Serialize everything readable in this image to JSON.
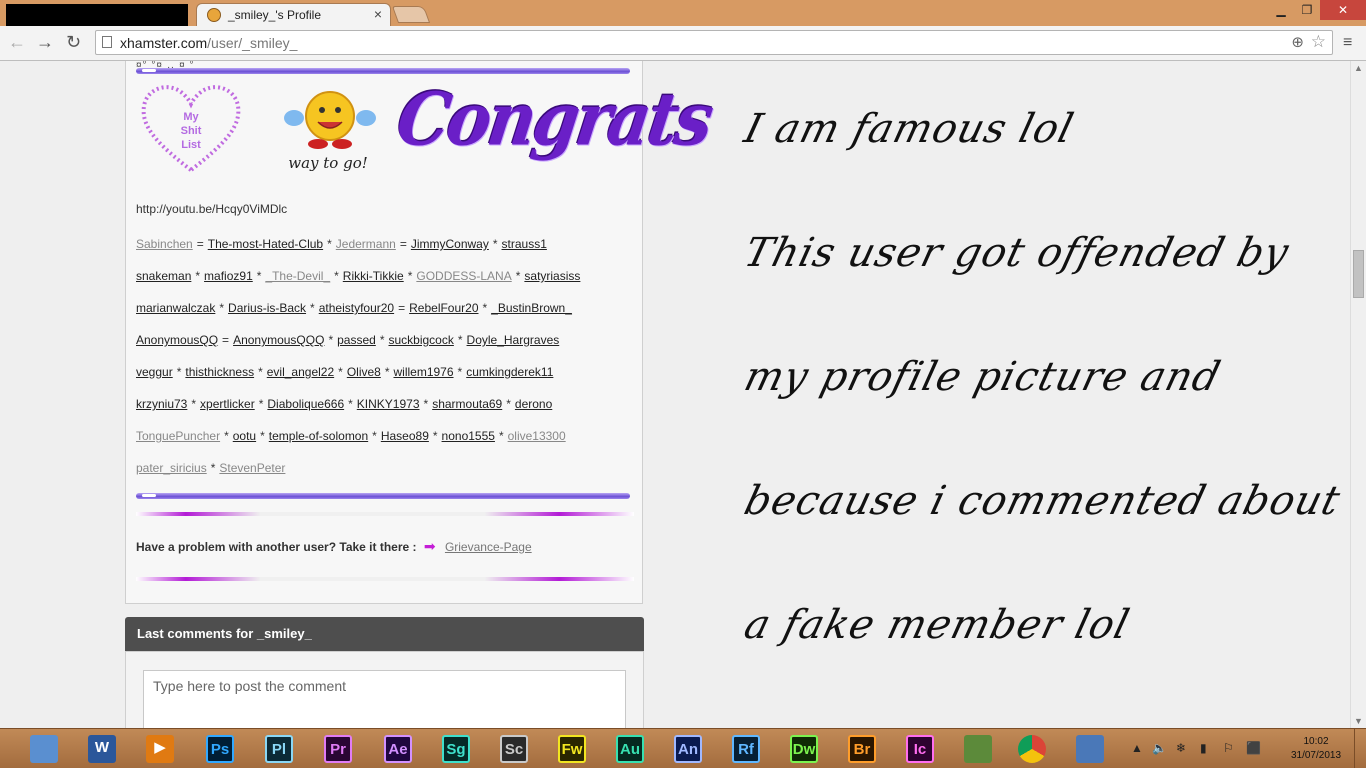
{
  "browser": {
    "tab_title": "_smiley_'s Profile",
    "tab_close": "×",
    "url_host": "xhamster.com",
    "url_path": "/user/_smiley_",
    "window_buttons": {
      "minimize": "▁",
      "maximize": "❐",
      "close": "✕"
    },
    "nav": {
      "back": "←",
      "forward": "→",
      "reload": "↻",
      "zoom": "⊕",
      "star": "☆",
      "menu": "≡"
    }
  },
  "profile": {
    "glyph_line": "¤°         °¤¸..¸¤ °",
    "heart_text": [
      "My",
      "Shit",
      "List"
    ],
    "smiley_caption": "way to go!",
    "congrats_text": "Congrats",
    "youtube_link": "http://youtu.be/Hcqy0ViMDlc",
    "user_lines": [
      [
        {
          "t": "Sabinchen",
          "g": 1
        },
        {
          "s": "="
        },
        {
          "t": "The-most-Hated-Club"
        },
        {
          "s": "*"
        },
        {
          "t": "Jedermann",
          "g": 1
        },
        {
          "s": "="
        },
        {
          "t": "JimmyConway"
        },
        {
          "s": "*"
        },
        {
          "t": "strauss1"
        }
      ],
      [
        {
          "t": "snakeman"
        },
        {
          "s": "*"
        },
        {
          "t": "mafioz91"
        },
        {
          "s": "*"
        },
        {
          "t": "_The-Devil_",
          "g": 1
        },
        {
          "s": "*"
        },
        {
          "t": "Rikki-Tikkie"
        },
        {
          "s": "*"
        },
        {
          "t": "GODDESS-LANA",
          "g": 1
        },
        {
          "s": "*"
        },
        {
          "t": "satyriasiss"
        }
      ],
      [
        {
          "t": "marianwalczak"
        },
        {
          "s": "*"
        },
        {
          "t": "Darius-is-Back"
        },
        {
          "s": "*"
        },
        {
          "t": "atheistyfour20"
        },
        {
          "s": "="
        },
        {
          "t": "RebelFour20"
        },
        {
          "s": "*"
        },
        {
          "t": "_BustinBrown_"
        }
      ],
      [
        {
          "t": "AnonymousQQ"
        },
        {
          "s": "="
        },
        {
          "t": "AnonymousQQQ"
        },
        {
          "s": "*"
        },
        {
          "t": "passed"
        },
        {
          "s": "*"
        },
        {
          "t": "suckbigcock"
        },
        {
          "s": "*"
        },
        {
          "t": "Doyle_Hargraves"
        }
      ],
      [
        {
          "t": "veggur"
        },
        {
          "s": "*"
        },
        {
          "t": "thisthickness"
        },
        {
          "s": "*"
        },
        {
          "t": "evil_angel22"
        },
        {
          "s": "*"
        },
        {
          "t": "Olive8"
        },
        {
          "s": "*"
        },
        {
          "t": "willem1976"
        },
        {
          "s": "*"
        },
        {
          "t": "cumkingderek11"
        }
      ],
      [
        {
          "t": "krzyniu73"
        },
        {
          "s": "*"
        },
        {
          "t": "xpertlicker"
        },
        {
          "s": "*"
        },
        {
          "t": "Diabolique666"
        },
        {
          "s": "*"
        },
        {
          "t": "KINKY1973"
        },
        {
          "s": "*"
        },
        {
          "t": "sharmouta69"
        },
        {
          "s": "*"
        },
        {
          "t": "derono"
        }
      ],
      [
        {
          "t": "TonguePuncher",
          "g": 1
        },
        {
          "s": "*"
        },
        {
          "t": "ootu"
        },
        {
          "s": "*"
        },
        {
          "t": "temple-of-solomon"
        },
        {
          "s": "*"
        },
        {
          "t": "Haseo89"
        },
        {
          "s": "*"
        },
        {
          "t": "nono1555"
        },
        {
          "s": "*"
        },
        {
          "t": "olive13300",
          "g": 1
        }
      ],
      [
        {
          "t": "pater_siricius",
          "g": 1
        },
        {
          "s": "*"
        },
        {
          "t": "StevenPeter",
          "g": 1
        }
      ]
    ],
    "problem_text": "Have a problem with another user? Take it there :",
    "grievance_link": "Grievance-Page"
  },
  "comments": {
    "title": "Last comments for _smiley_",
    "placeholder": "Type here to post the comment"
  },
  "script_text": [
    "I am famous lol",
    "This user got offended by",
    "my profile picture and",
    "because i commented about",
    "a fake member lol"
  ],
  "taskbar": {
    "apps": [
      {
        "name": "control-panel",
        "label": "",
        "fg": "#ffffff",
        "bg": "#5a8fd0"
      },
      {
        "name": "word",
        "label": "W",
        "fg": "#ffffff",
        "bg": "#2b579a"
      },
      {
        "name": "media-player",
        "label": "▶",
        "fg": "#ffffff",
        "bg": "#e07a12"
      },
      {
        "name": "photoshop",
        "label": "Ps",
        "fg": "#31a8ff",
        "bg": "#001e36"
      },
      {
        "name": "prelude",
        "label": "Pl",
        "fg": "#8ad7f5",
        "bg": "#0b2a36"
      },
      {
        "name": "premiere",
        "label": "Pr",
        "fg": "#e07cf5",
        "bg": "#2a0634"
      },
      {
        "name": "after-effects",
        "label": "Ae",
        "fg": "#d291ff",
        "bg": "#1f0740"
      },
      {
        "name": "speedgrade",
        "label": "Sg",
        "fg": "#3ee0cc",
        "bg": "#052a27"
      },
      {
        "name": "scout",
        "label": "Sc",
        "fg": "#c9c9c9",
        "bg": "#2a2a2a"
      },
      {
        "name": "fireworks",
        "label": "Fw",
        "fg": "#f2e520",
        "bg": "#2a2600"
      },
      {
        "name": "audition",
        "label": "Au",
        "fg": "#37e0b0",
        "bg": "#052a20"
      },
      {
        "name": "animate",
        "label": "An",
        "fg": "#a0b8ff",
        "bg": "#0a1a50"
      },
      {
        "name": "flash",
        "label": "Rf",
        "fg": "#5fb7ff",
        "bg": "#061f33"
      },
      {
        "name": "dreamweaver",
        "label": "Dw",
        "fg": "#7cf34e",
        "bg": "#0f2a05"
      },
      {
        "name": "bridge",
        "label": "Br",
        "fg": "#ff9d2a",
        "bg": "#2a1600"
      },
      {
        "name": "incopy",
        "label": "Ic",
        "fg": "#ff6ef0",
        "bg": "#2d0330"
      },
      {
        "name": "minecraft",
        "label": "",
        "fg": "#ffffff",
        "bg": "#5c8a3a"
      },
      {
        "name": "chrome",
        "label": "",
        "fg": "#ffffff",
        "bg": "#e3e3e3"
      },
      {
        "name": "paint",
        "label": "",
        "fg": "#ffffff",
        "bg": "#4a78b8"
      }
    ],
    "tray": [
      "▲",
      "🔈",
      "❄",
      "▮",
      "⚐",
      "⬛"
    ],
    "time": "10:02",
    "date": "31/07/2013"
  }
}
